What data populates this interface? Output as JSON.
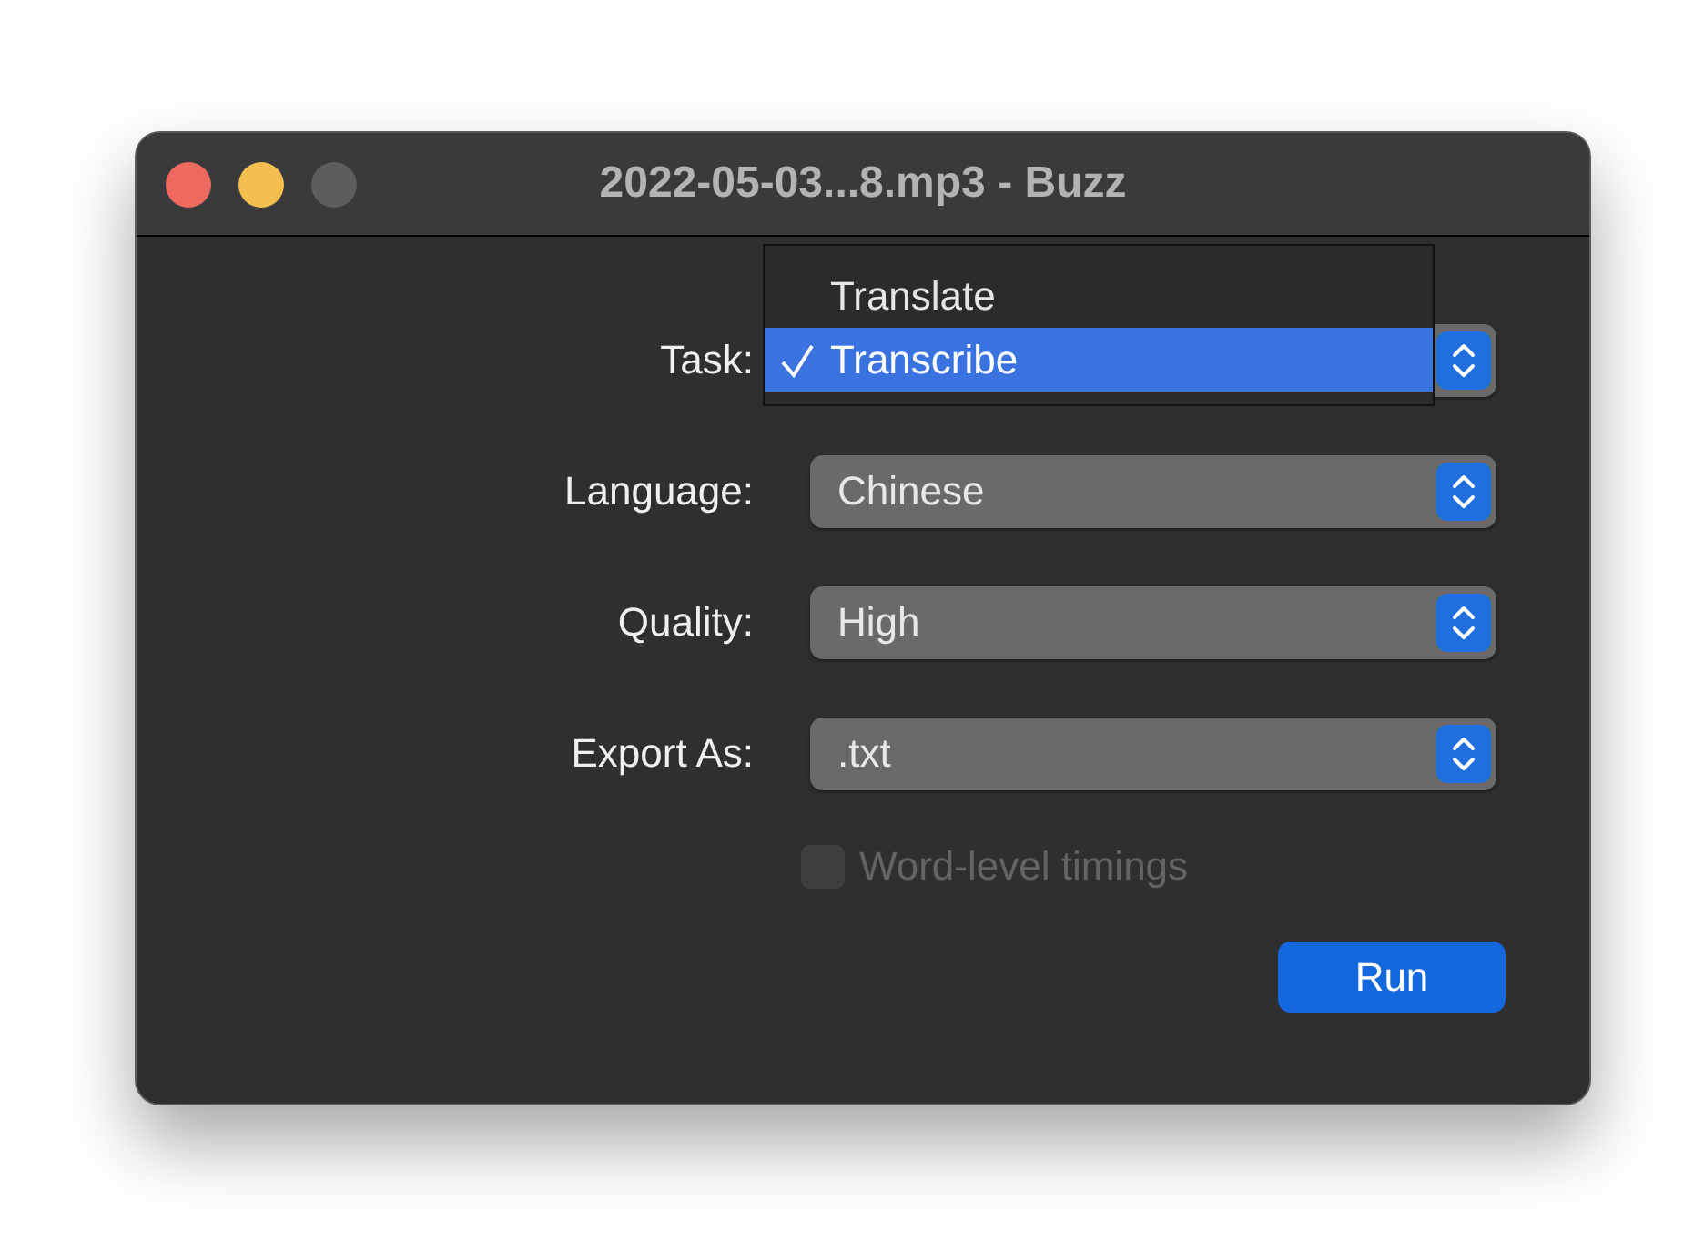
{
  "window": {
    "title": "2022-05-03...8.mp3 - Buzz"
  },
  "fields": [
    {
      "kind": "popup-open",
      "label": "Task:",
      "options": [
        {
          "label": "Translate",
          "selected": false
        },
        {
          "label": "Transcribe",
          "selected": true
        }
      ]
    },
    {
      "kind": "select",
      "label": "Language:",
      "value": "Chinese"
    },
    {
      "kind": "select",
      "label": "Quality:",
      "value": "High"
    },
    {
      "kind": "select",
      "label": "Export As:",
      "value": ".txt"
    }
  ],
  "checkbox": {
    "label": "Word-level timings",
    "checked": false,
    "disabled": true
  },
  "buttons": [
    "Run"
  ]
}
